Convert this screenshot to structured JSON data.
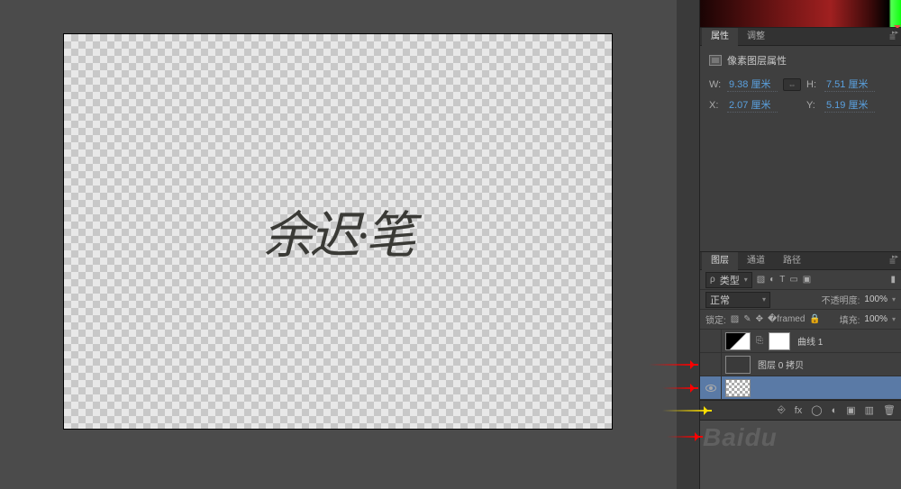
{
  "canvas": {
    "signature": "余迟·笔"
  },
  "props": {
    "tabs": [
      "属性",
      "调整"
    ],
    "title": "像素图层属性",
    "w_label": "W:",
    "w_val": "9.38 厘米",
    "h_label": "H:",
    "h_val": "7.51 厘米",
    "x_label": "X:",
    "x_val": "2.07 厘米",
    "y_label": "Y:",
    "y_val": "5.19 厘米"
  },
  "layers": {
    "tabs": [
      "图层",
      "通道",
      "路径"
    ],
    "kind_label": "类型",
    "blend_label": "正常",
    "opacity_label": "不透明度:",
    "opacity_val": "100%",
    "lock_label": "锁定:",
    "fill_label": "填充:",
    "fill_val": "100%",
    "items": [
      {
        "name": "曲线 1",
        "type": "adjustment"
      },
      {
        "name": "图层 0 拷贝",
        "type": "pixel"
      },
      {
        "name": "",
        "type": "selected"
      }
    ]
  },
  "watermark": "Baidu"
}
